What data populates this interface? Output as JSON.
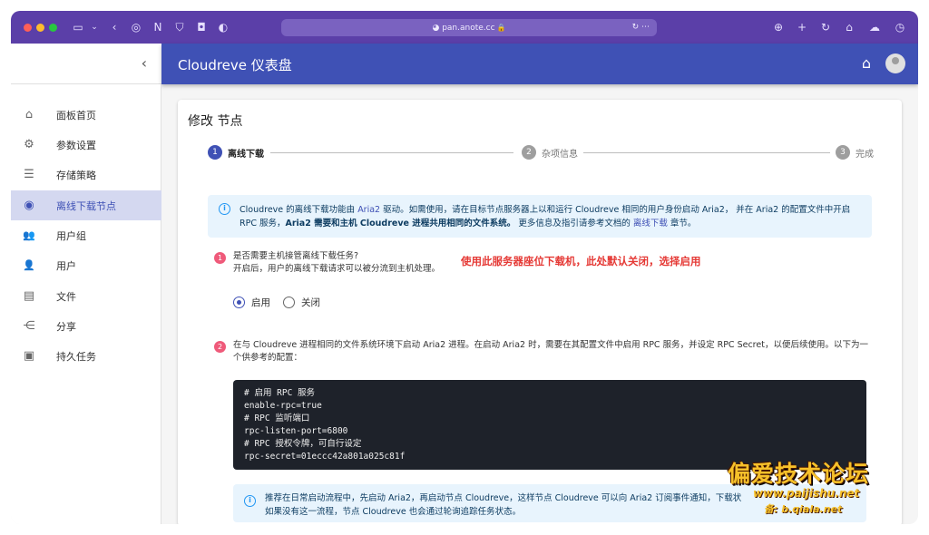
{
  "browser": {
    "url": "pan.anote.cc",
    "traffic_colors": [
      "#ff5f57",
      "#febc2e",
      "#28c840"
    ]
  },
  "app": {
    "title": "Cloudreve 仪表盘"
  },
  "sidebar": {
    "items": [
      {
        "label": "面板首页",
        "icon": "home-icon",
        "glyph": "⌂"
      },
      {
        "label": "参数设置",
        "icon": "gear-icon",
        "glyph": "⚙"
      },
      {
        "label": "存储策略",
        "icon": "storage-icon",
        "glyph": "☰"
      },
      {
        "label": "离线下载节点",
        "icon": "download-node-icon",
        "glyph": "◉",
        "active": true
      },
      {
        "label": "用户组",
        "icon": "group-icon",
        "glyph": "👥"
      },
      {
        "label": "用户",
        "icon": "user-icon",
        "glyph": "👤"
      },
      {
        "label": "文件",
        "icon": "file-icon",
        "glyph": "▤"
      },
      {
        "label": "分享",
        "icon": "share-icon",
        "glyph": "⋲"
      },
      {
        "label": "持久任务",
        "icon": "task-icon",
        "glyph": "▣"
      }
    ]
  },
  "main": {
    "title": "修改 节点",
    "steps": [
      {
        "num": "1",
        "label": "离线下载"
      },
      {
        "num": "2",
        "label": "杂项信息"
      },
      {
        "num": "3",
        "label": "完成"
      }
    ],
    "info": {
      "p1": "Cloudreve 的离线下载功能由 ",
      "link1": "Aria2",
      "p2": " 驱动。如需使用，请在目标节点服务器上以和运行 Cloudreve 相同的用户身份启动 Aria2， 并在 Aria2 的配置文件中开启 RPC 服务，",
      "bold": "Aria2 需要和主机 Cloudreve 进程共用相同的文件系统。",
      "p3": " 更多信息及指引请参考文档的 ",
      "link2": "离线下载",
      "p4": " 章节。"
    },
    "q1": {
      "num": "1",
      "line1": "是否需要主机接管离线下载任务?",
      "line2": "开启后，用户的离线下载请求可以被分流到主机处理。",
      "annotation": "使用此服务器座位下载机，此处默认关闭，选择启用",
      "options": [
        "启用",
        "关闭"
      ],
      "selected": "启用"
    },
    "q2": {
      "num": "2",
      "text": "在与 Cloudreve 进程相同的文件系统环境下启动 Aria2 进程。在启动 Aria2 时，需要在其配置文件中启用 RPC 服务，并设定 RPC Secret，以便后续使用。以下为一个供参考的配置：",
      "code": "# 启用 RPC 服务\nenable-rpc=true\n# RPC 监听端口\nrpc-listen-port=6800\n# RPC 授权令牌，可自行设定\nrpc-secret=01eccc42a801a025c81f"
    },
    "info2": {
      "line1": "推荐在日常启动流程中，先启动 Aria2，再启动节点 Cloudreve，这样节点 Cloudreve 可以向 Aria2 订阅事件通知，下载状",
      "line2": "如果没有这一流程，节点 Cloudreve 也会通过轮询追踪任务状态。"
    }
  },
  "watermark": {
    "big": "偏爱技术论坛",
    "url": "www.paijishu.net",
    "sub": "备: b.qiala.net"
  }
}
